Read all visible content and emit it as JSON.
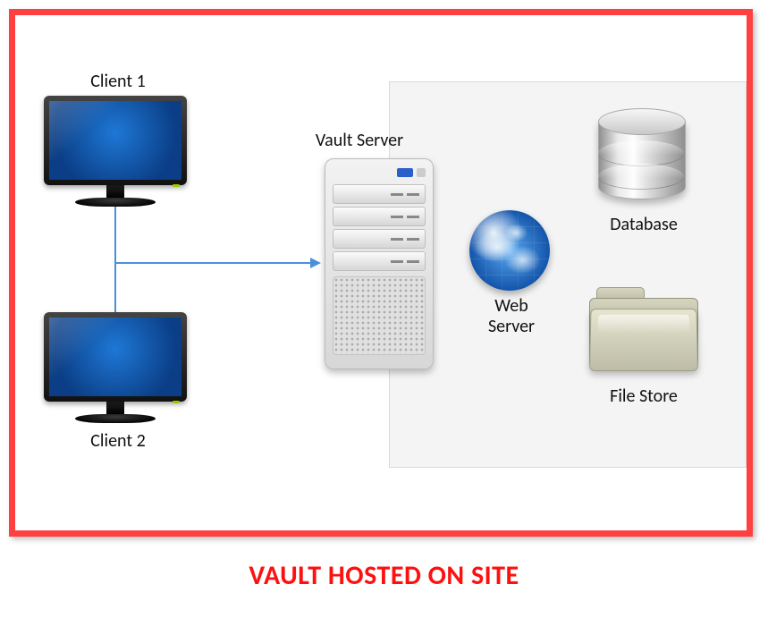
{
  "caption": "VAULT HOSTED ON SITE",
  "client1_label": "Client 1",
  "client2_label": "Client 2",
  "server_label": "Vault Server",
  "web_label_line1": "Web",
  "web_label_line2": "Server",
  "database_label": "Database",
  "filestore_label": "File Store",
  "colors": {
    "frame_border": "#ff4040",
    "caption_text": "#ff1010",
    "connector": "#4a90d9"
  }
}
